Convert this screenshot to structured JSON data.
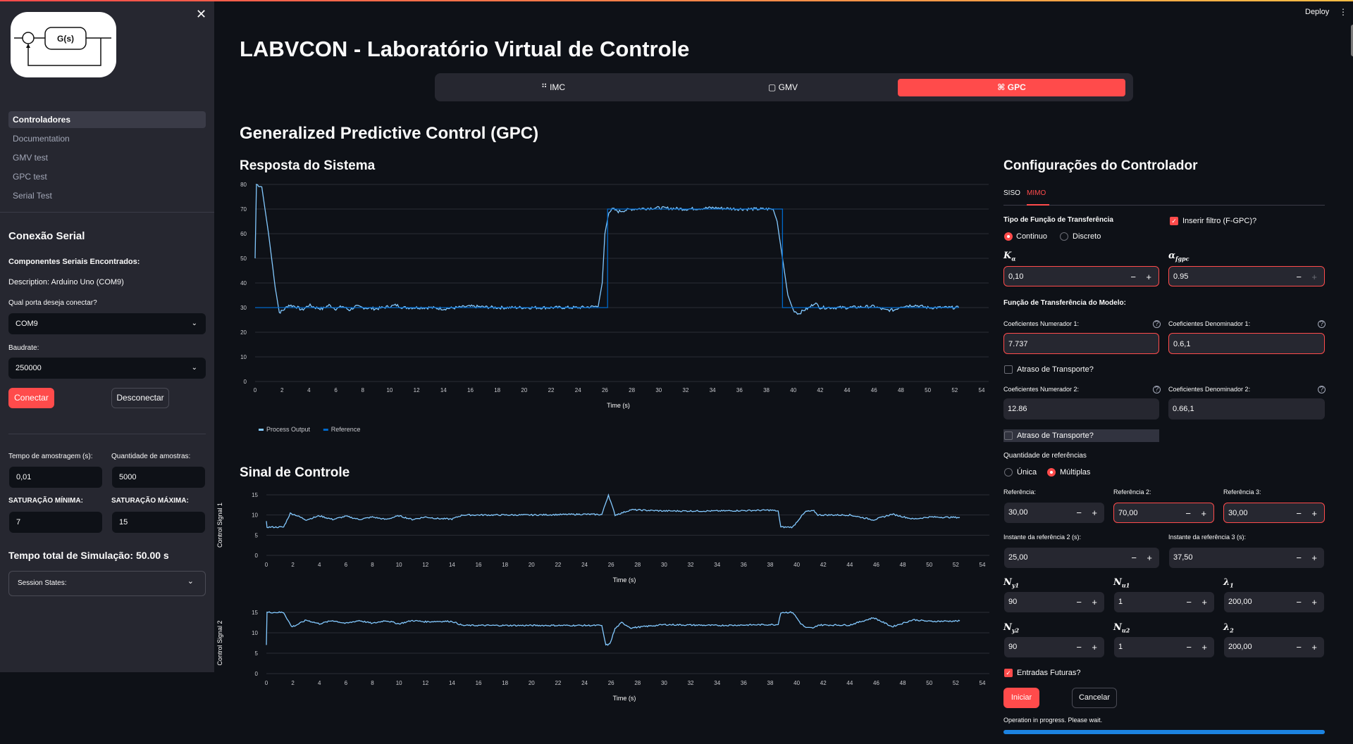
{
  "app": {
    "deploy_label": "Deploy",
    "title": "LABVCON - Laboratório Virtual de Controle"
  },
  "sidebar": {
    "logo_text": "G(s)",
    "nav": [
      {
        "label": "Controladores",
        "active": true
      },
      {
        "label": "Documentation",
        "active": false
      },
      {
        "label": "GMV test",
        "active": false
      },
      {
        "label": "GPC test",
        "active": false
      },
      {
        "label": "Serial Test",
        "active": false
      }
    ],
    "serial": {
      "header": "Conexão Serial",
      "found_label": "Componentes Seriais Encontrados:",
      "description": "Description: Arduino Uno (COM9)",
      "port_label": "Qual porta deseja conectar?",
      "port_value": "COM9",
      "baud_label": "Baudrate:",
      "baud_value": "250000",
      "connect": "Conectar",
      "disconnect": "Desconectar"
    },
    "sampling_time_label": "Tempo de amostragem (s):",
    "sampling_time_value": "0,01",
    "samples_label": "Quantidade de amostras:",
    "samples_value": "5000",
    "sat_min_label": "SATURAÇÃO MÍNIMA:",
    "sat_min_value": "7",
    "sat_max_label": "SATURAÇÃO MÁXIMA:",
    "sat_max_value": "15",
    "total_time": "Tempo total de Simulação: 50.00 s",
    "session_states": "Session States:"
  },
  "tabs": [
    {
      "label": "IMC",
      "icon": "grid-icon",
      "active": false
    },
    {
      "label": "GMV",
      "icon": "square-icon",
      "active": false
    },
    {
      "label": "GPC",
      "icon": "command-icon",
      "active": true
    }
  ],
  "main": {
    "section_title": "Generalized Predictive Control (GPC)",
    "response_title": "Resposta do Sistema",
    "control_title": "Sinal de Controle"
  },
  "config": {
    "title": "Configurações do Controlador",
    "subtabs": [
      {
        "label": "SISO",
        "active": false
      },
      {
        "label": "MIMO",
        "active": true
      }
    ],
    "tf_type_label": "Tipo de Função de Transferência",
    "tf_options": [
      {
        "label": "Continuo",
        "selected": true
      },
      {
        "label": "Discreto",
        "selected": false
      }
    ],
    "filter_label": "Inserir filtro (F-GPC)?",
    "filter_checked": true,
    "k_alpha_label": "K",
    "k_alpha_sub": "α",
    "k_alpha_value": "0,10",
    "alpha_label": "α",
    "alpha_sub": "fgpc",
    "alpha_value": "0.95",
    "model_label": "Função de Transferência do Modelo:",
    "num1_label": "Coeficientes Numerador 1:",
    "num1_value": "7.737",
    "den1_label": "Coeficientes Denominador 1:",
    "den1_value": "0.6,1",
    "delay1_label": "Atraso de Transporte?",
    "num2_label": "Coeficientes Numerador 2:",
    "num2_value": "12.86",
    "den2_label": "Coeficientes Denominador 2:",
    "den2_value": "0.66,1",
    "delay2_label": "Atraso de Transporte?",
    "ref_qty_label": "Quantidade de referências",
    "ref_options": [
      {
        "label": "Única",
        "selected": false
      },
      {
        "label": "Múltiplas",
        "selected": true
      }
    ],
    "ref1_label": "Referência:",
    "ref1_value": "30,00",
    "ref2_label": "Referência 2:",
    "ref2_value": "70,00",
    "ref3_label": "Referência 3:",
    "ref3_value": "30,00",
    "t2_label": "Instante da referência 2 (s):",
    "t2_value": "25,00",
    "t3_label": "Instante da referência 3 (s):",
    "t3_value": "37,50",
    "ny1": {
      "label": "N",
      "sub": "y1",
      "value": "90"
    },
    "nu1": {
      "label": "N",
      "sub": "u1",
      "value": "1"
    },
    "lambda1": {
      "label": "λ",
      "sub": "1",
      "value": "200,00"
    },
    "ny2": {
      "label": "N",
      "sub": "y2",
      "value": "90"
    },
    "nu2": {
      "label": "N",
      "sub": "u2",
      "value": "1"
    },
    "lambda2": {
      "label": "λ",
      "sub": "2",
      "value": "200,00"
    },
    "future_inputs_label": "Entradas Futuras?",
    "future_inputs_checked": true,
    "start": "Iniciar",
    "cancel": "Cancelar",
    "status": "Operation in progress. Please wait.",
    "progress": 1.0
  },
  "chart_data": [
    {
      "type": "line",
      "title": "Resposta do Sistema",
      "xlabel": "Time (s)",
      "ylabel": "",
      "xlim": [
        0,
        54
      ],
      "ylim": [
        0,
        80
      ],
      "xticks": [
        0,
        2,
        4,
        6,
        8,
        10,
        12,
        14,
        16,
        18,
        20,
        22,
        24,
        26,
        28,
        30,
        32,
        34,
        36,
        38,
        40,
        42,
        44,
        46,
        48,
        50,
        52,
        54
      ],
      "yticks": [
        0,
        10,
        20,
        30,
        40,
        50,
        60,
        70,
        80
      ],
      "grid": true,
      "legend": "bottom-left",
      "series": [
        {
          "name": "Process Output",
          "color": "#83c9ff",
          "x": [
            0,
            0.1,
            0.5,
            1,
            1.5,
            1.8,
            2.1,
            2.5,
            3,
            3.5,
            4,
            4.5,
            5,
            5.5,
            6,
            6.5,
            7,
            7.5,
            8,
            9,
            10,
            10.5,
            11,
            12,
            13,
            14,
            15,
            16,
            18,
            20,
            22,
            24,
            25.5,
            25.8,
            26,
            26.3,
            26.6,
            27,
            28,
            30,
            32,
            34,
            36,
            38,
            38.5,
            38.8,
            39.2,
            39.6,
            40,
            40.4,
            40.8,
            41.2,
            41.6,
            42,
            44,
            46,
            46.8,
            47.5,
            48,
            49,
            50,
            51,
            52.3
          ],
          "y": [
            50,
            80,
            79,
            60,
            38,
            28,
            29,
            31,
            30.5,
            29,
            31,
            30,
            29.5,
            31,
            29.5,
            30.5,
            29,
            30.5,
            30,
            29.5,
            30.5,
            31,
            30,
            30,
            30,
            29.5,
            30,
            30.5,
            30,
            30,
            30,
            30,
            30.5,
            40,
            60,
            69,
            70,
            69,
            70,
            70.5,
            70,
            70.5,
            70,
            70,
            70,
            65,
            50,
            35,
            29,
            27.5,
            29,
            30,
            32,
            30,
            30,
            30.5,
            29,
            29,
            30.5,
            31,
            30,
            30,
            30
          ]
        },
        {
          "name": "Reference",
          "color": "#0068c9",
          "x": [
            0,
            26.2,
            26.2,
            39.2,
            39.2,
            52.3
          ],
          "y": [
            30,
            30,
            70,
            70,
            30,
            30
          ]
        }
      ]
    },
    {
      "type": "line",
      "title": "Control Signal 1",
      "xlabel": "Time (s)",
      "ylabel": "Control Signal 1",
      "xlim": [
        0,
        54
      ],
      "ylim": [
        0,
        15
      ],
      "xticks": [
        0,
        2,
        4,
        6,
        8,
        10,
        12,
        14,
        16,
        18,
        20,
        22,
        24,
        26,
        28,
        30,
        32,
        34,
        36,
        38,
        40,
        42,
        44,
        46,
        48,
        50,
        52,
        54
      ],
      "yticks": [
        0,
        5,
        10,
        15
      ],
      "grid": true,
      "series": [
        {
          "name": "Control Signal 1",
          "color": "#83c9ff",
          "x": [
            0,
            0.05,
            1.3,
            1.8,
            2.2,
            3,
            4,
            5,
            6,
            7,
            8,
            9,
            10,
            11,
            12,
            13,
            14,
            14.8,
            16,
            20,
            24,
            25.3,
            25.8,
            26.3,
            26.8,
            27.5,
            30,
            34,
            38,
            38.6,
            38.8,
            39.7,
            40.3,
            40.7,
            41.3,
            41.6,
            44,
            45.8,
            47.2,
            48.8,
            50,
            52.3
          ],
          "y": [
            8.5,
            7,
            7,
            10.4,
            10,
            8.8,
            9.8,
            8.9,
            9.7,
            8.9,
            9.5,
            8.9,
            9.8,
            8.9,
            9.5,
            9.1,
            9,
            10,
            10,
            10,
            10.2,
            10.1,
            15,
            10,
            10.5,
            11.3,
            11,
            11,
            11.2,
            11,
            7,
            7,
            9.5,
            10.9,
            11,
            10,
            10,
            8.8,
            10.2,
            9,
            9.5,
            9.4
          ]
        }
      ]
    },
    {
      "type": "line",
      "title": "Control Signal 2",
      "xlabel": "Time (s)",
      "ylabel": "Control Signal 2",
      "xlim": [
        0,
        54
      ],
      "ylim": [
        0,
        15
      ],
      "xticks": [
        0,
        2,
        4,
        6,
        8,
        10,
        12,
        14,
        16,
        18,
        20,
        22,
        24,
        26,
        28,
        30,
        32,
        34,
        36,
        38,
        40,
        42,
        44,
        46,
        48,
        50,
        52,
        54
      ],
      "yticks": [
        0,
        5,
        10,
        15
      ],
      "grid": true,
      "series": [
        {
          "name": "Control Signal 2",
          "color": "#83c9ff",
          "x": [
            0,
            0.05,
            1.3,
            1.9,
            2.2,
            3,
            4,
            5,
            6,
            7,
            8,
            9,
            10,
            11,
            12,
            13,
            14,
            14.8,
            16,
            20,
            24,
            25.3,
            25.6,
            25.9,
            26.3,
            26.8,
            27.5,
            30,
            34,
            38,
            38.6,
            38.8,
            39.7,
            40.3,
            40.7,
            41.3,
            41.6,
            44,
            45.8,
            47.2,
            48.8,
            50,
            52.3
          ],
          "y": [
            7,
            15,
            15,
            11.5,
            11.8,
            13.1,
            12.2,
            13,
            12.3,
            13,
            12.3,
            13,
            12.2,
            13,
            12.7,
            12.8,
            12.8,
            11.8,
            11.8,
            11.8,
            11.8,
            11.8,
            7,
            7.2,
            11,
            12.5,
            11.2,
            12,
            11.8,
            12,
            12,
            15,
            15,
            12.3,
            11.2,
            11.2,
            11.9,
            11.9,
            13.7,
            11.5,
            13.2,
            12.8,
            12.9
          ]
        }
      ]
    }
  ]
}
